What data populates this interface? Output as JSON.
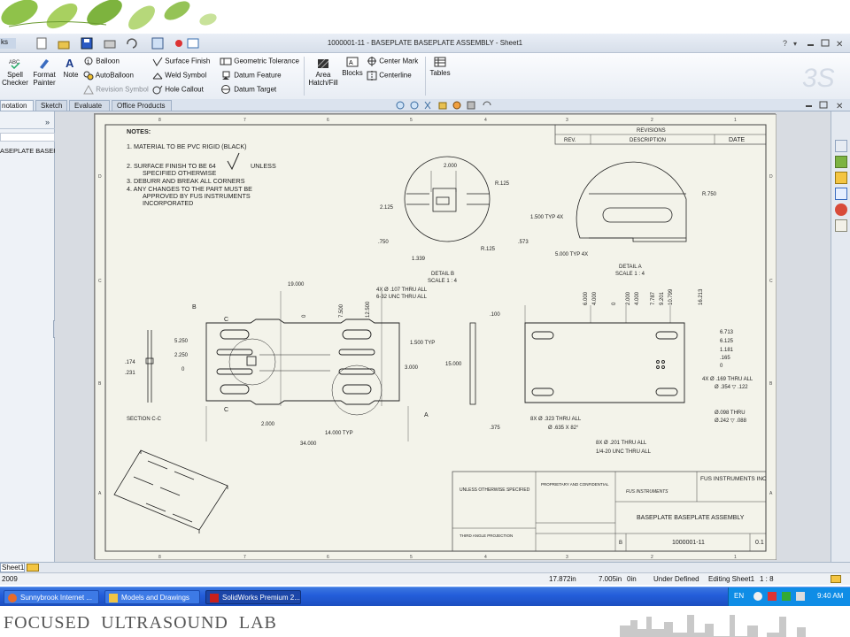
{
  "window": {
    "title": "1000001-11 - BASEPLATE BASEPLATE ASSEMBLY - Sheet1",
    "menu_fragment": "ks"
  },
  "ribbon": {
    "spell_checker": "Spell Checker",
    "format_painter": "Format Painter",
    "note": "Note",
    "balloon": "Balloon",
    "autoballoon": "AutoBalloon",
    "revision_symbol": "Revision Symbol",
    "surface_finish": "Surface Finish",
    "weld_symbol": "Weld Symbol",
    "hole_callout": "Hole Callout",
    "geometric_tolerance": "Geometric Tolerance",
    "datum_feature": "Datum Feature",
    "datum_target": "Datum Target",
    "area_hatch": "Area Hatch/Fill",
    "blocks": "Blocks",
    "center_mark": "Center Mark",
    "centerline": "Centerline",
    "tables": "Tables"
  },
  "tabs": [
    "notation",
    "Sketch",
    "Evaluate",
    "Office Products"
  ],
  "left_panel": {
    "tree_item": "ASEPLATE BASEPL"
  },
  "drawing": {
    "notes_title": "NOTES:",
    "notes": [
      "1.   MATERIAL TO BE PVC RIGID (BLACK)",
      "2.   SURFACE FINISH TO BE 64",
      "UNLESS",
      "SPECIFIED OTHERWISE",
      "3.   DEBURR AND BREAK ALL CORNERS",
      "4.   ANY CHANGES TO THE PART MUST BE",
      "APPROVED BY FUS INSTRUMENTS",
      "INCORPORATED"
    ],
    "revisions": {
      "title": "REVISIONS",
      "rev": "REV.",
      "description": "DESCRIPTION",
      "date": "DATE"
    },
    "detail_b": {
      "label": "DETAIL B",
      "scale": "SCALE 1 : 4",
      "dims": [
        "2.000",
        "R.125",
        "2.125",
        "R.125",
        ".750",
        ".573",
        "1.339"
      ]
    },
    "detail_a": {
      "label": "DETAIL A",
      "scale": "SCALE 1 : 4",
      "dims": [
        "R.750",
        "1.500 TYP 4X",
        "5.000 TYP 4X"
      ]
    },
    "main_view": {
      "top_dims": [
        "19.000",
        "0",
        "7.500",
        "12.500"
      ],
      "left_dims": [
        "5.250",
        "2.250",
        "0"
      ],
      "right_dims": [
        "1.500 TYP",
        "3.000"
      ],
      "bottom_dims": [
        "2.000",
        "14.000 TYP",
        "34.000"
      ],
      "callout": [
        "4X  Ø .107 THRU ALL",
        "6-32 UNC   THRU ALL"
      ],
      "labels": [
        "B",
        "C",
        "C",
        "A"
      ]
    },
    "section": {
      "label": "SECTION C-C",
      "dims": [
        ".174",
        ".231"
      ]
    },
    "side_view": {
      "dims": [
        ".100",
        "15.000",
        ".375"
      ]
    },
    "right_view": {
      "top_dims": [
        "6.000",
        "4.000",
        "0",
        "2.000",
        "4.000",
        "7.787",
        "9.201",
        "10.799",
        "16.213"
      ],
      "right_dims": [
        "6.713",
        "6.125",
        "1.181",
        ".165",
        "0"
      ],
      "callouts": [
        "4X  Ø .169 THRU ALL",
        "Ø .354 ▽ .122",
        "Ø.098 THRU",
        "Ø.242 ▽ .088",
        "8X  Ø .323 THRU ALL",
        "Ø .635 X 82°",
        "8X  Ø .201 THRU ALL",
        "1/4-20 UNC   THRU ALL"
      ]
    },
    "zones_top": [
      "8",
      "7",
      "6",
      "5",
      "4",
      "3",
      "2",
      "1"
    ],
    "zones_side": [
      "D",
      "C",
      "B",
      "A"
    ],
    "title_block": {
      "unless": "UNLESS OTHERWISE SPECIFIED",
      "company": "FUS INSTRUMENTS INC",
      "logo": "FUS INSTRUMENTS",
      "title": "BASEPLATE BASEPLATE ASSEMBLY",
      "size": "B",
      "part_no": "1000001-11",
      "rev": "0.1",
      "proprietary": "PROPRIETARY AND CONFIDENTIAL",
      "third_angle": "THIRD ANGLE PROJECTION"
    }
  },
  "sheet_tab": "Sheet1",
  "status": {
    "left": "2009",
    "x": "17.872in",
    "y": "7.005in",
    "z": "0in",
    "state": "Under Defined",
    "editing": "Editing Sheet1",
    "scale": "1 : 8"
  },
  "taskbar": {
    "items": [
      "Sunnybrook Internet ...",
      "Models and Drawings",
      "SolidWorks Premium 2..."
    ],
    "lang": "EN",
    "clock": "9:40 AM"
  },
  "footer": {
    "text": "FOCUSED  ULTRASOUND  LAB"
  }
}
